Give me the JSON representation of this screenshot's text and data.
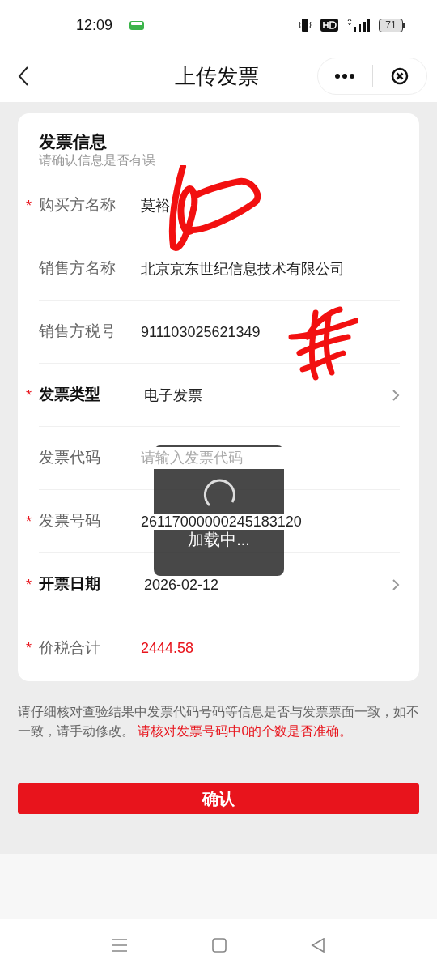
{
  "status_bar": {
    "time": "12:09",
    "battery": "71"
  },
  "header": {
    "title": "上传发票"
  },
  "card": {
    "title": "发票信息",
    "subtitle": "请确认信息是否有误",
    "rows": [
      {
        "required_mark": "*",
        "label": "购买方名称",
        "value": "莫裕",
        "kind": "text"
      },
      {
        "label": "销售方名称",
        "value": "北京京东世纪信息技术有限公司",
        "kind": "text"
      },
      {
        "label": "销售方税号",
        "value": "911103025621349",
        "kind": "text"
      },
      {
        "required_mark": "*",
        "label": "发票类型",
        "value": "电子发票",
        "kind": "select"
      },
      {
        "label": "发票代码",
        "placeholder": "请输入发票代码",
        "kind": "input"
      },
      {
        "required_mark": "*",
        "label": "发票号码",
        "value": "26117000000245183120",
        "kind": "text"
      },
      {
        "required_mark": "*",
        "label": "开票日期",
        "value": "2026-02-12",
        "kind": "select"
      },
      {
        "required_mark": "*",
        "label": "价税合计",
        "value": "2444.58",
        "kind": "amount"
      }
    ]
  },
  "note": {
    "text": "请仔细核对查验结果中发票代码号码等信息是否与发票票面一致，如不一致，请手动修改。",
    "warning": "请核对发票号码中0的个数是否准确。"
  },
  "confirm_button": "确认",
  "loading": {
    "text": "加载中..."
  }
}
